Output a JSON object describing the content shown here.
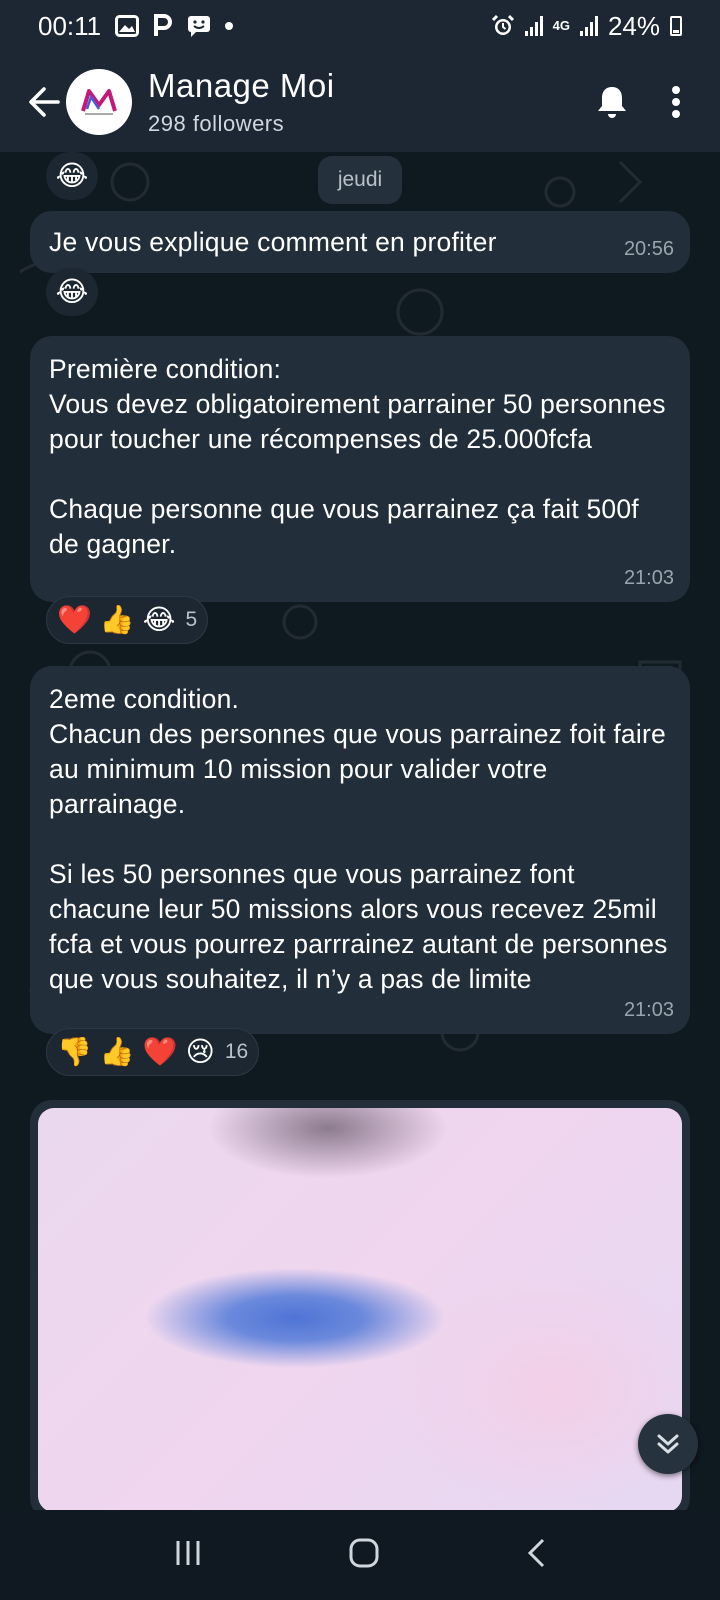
{
  "status_bar": {
    "time": "00:11",
    "network": "4G",
    "battery": "24%"
  },
  "header": {
    "channel_name": "Manage Moi",
    "followers": "298 followers",
    "back_icon": "arrow-left-icon",
    "bell_icon": "bell-icon",
    "menu_icon": "more-vertical-icon"
  },
  "chat": {
    "date_label": "jeudi",
    "messages": [
      {
        "text": "Je vous explique comment en profiter",
        "time": "20:56",
        "reactions": [
          {
            "emoji": "😂"
          }
        ]
      },
      {
        "text": "Première condition:\nVous devez obligatoirement parrainer 50 personnes pour toucher une récompenses de 25.000fcfa\n\nChaque personne que vous parrainez ça fait 500f de gagner.",
        "time": "21:03",
        "reactions": [
          {
            "emoji": "❤️"
          },
          {
            "emoji": "👍"
          },
          {
            "emoji": "😂"
          }
        ],
        "reaction_count": "5"
      },
      {
        "text": "2eme condition.\nChacun des personnes que vous parrainez foit faire au minimum 10 mission pour valider votre parrainage.\n\nSi les 50 personnes que vous parrainez font chacune leur 50 missions alors vous recevez 25mil fcfa et vous pourrez parrrainez autant de personnes que vous souhaitez, il n’y a pas de limite",
        "time": "21:03",
        "reactions": [
          {
            "emoji": "👎"
          },
          {
            "emoji": "👍"
          },
          {
            "emoji": "❤️"
          },
          {
            "emoji": "😢"
          }
        ],
        "reaction_count": "16"
      }
    ],
    "top_reaction": "😂"
  },
  "colors": {
    "bubble": "#222e39",
    "background": "#0f1920",
    "header": "#1c2733",
    "heart": "#e0245e"
  }
}
